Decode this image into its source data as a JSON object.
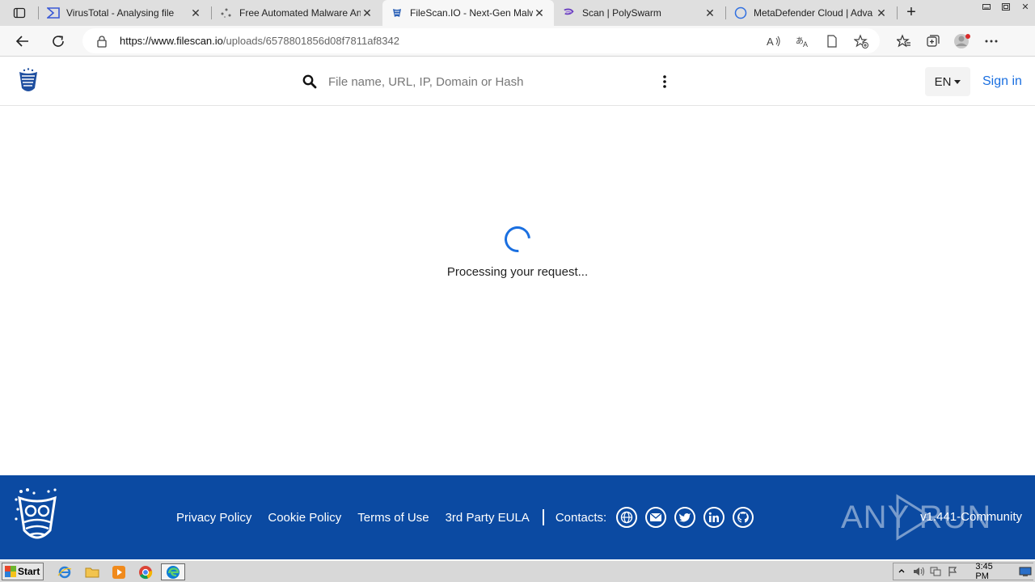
{
  "browser": {
    "tabs": [
      {
        "title": "VirusTotal - Analysing file",
        "icon": "virustotal-icon"
      },
      {
        "title": "Free Automated Malware Ana",
        "icon": "anyrun-icon"
      },
      {
        "title": "FileScan.IO - Next-Gen Malw",
        "icon": "filescan-icon",
        "active": true
      },
      {
        "title": "Scan | PolySwarm",
        "icon": "polyswarm-icon"
      },
      {
        "title": "MetaDefender Cloud | Adva",
        "icon": "metadefender-icon"
      }
    ],
    "url_host": "https://www.filescan.io",
    "url_path": "/uploads/6578801856d08f7811af8342"
  },
  "site": {
    "search_placeholder": "File name, URL, IP, Domain or Hash",
    "lang": "EN",
    "signin": "Sign in"
  },
  "main": {
    "status": "Processing your request..."
  },
  "footer": {
    "links": [
      "Privacy Policy",
      "Cookie Policy",
      "Terms of Use",
      "3rd Party EULA"
    ],
    "contacts_label": "Contacts:",
    "contact_icons": [
      "globe-icon",
      "mail-icon",
      "twitter-icon",
      "linkedin-icon",
      "github-icon"
    ],
    "version": "v1.441-Community",
    "watermark": "ANY RUN"
  },
  "taskbar": {
    "start": "Start",
    "clock": "3:45 PM"
  },
  "colors": {
    "accent": "#1a6fe0",
    "footer_bg": "#0b4aa2"
  }
}
